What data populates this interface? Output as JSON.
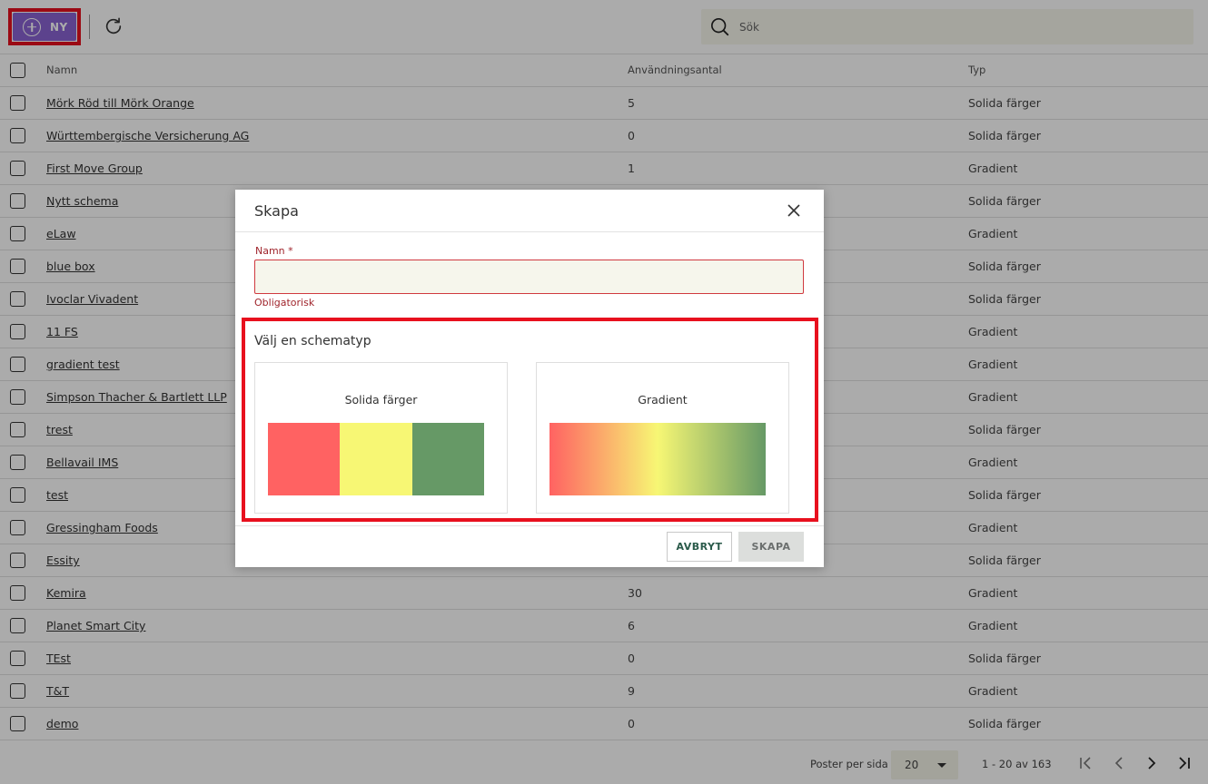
{
  "toolbar": {
    "new_label": "NY",
    "search_placeholder": "Sök"
  },
  "table": {
    "headers": {
      "name": "Namn",
      "count": "Användningsantal",
      "type": "Typ"
    },
    "rows": [
      {
        "name": "Mörk Röd till Mörk Orange",
        "count": "5",
        "type": "Solida färger"
      },
      {
        "name": "Württembergische Versicherung AG",
        "count": "0",
        "type": "Solida färger"
      },
      {
        "name": "First Move Group",
        "count": "1",
        "type": "Gradient"
      },
      {
        "name": "Nytt schema",
        "count": "",
        "type": "Solida färger"
      },
      {
        "name": "eLaw",
        "count": "",
        "type": "Gradient"
      },
      {
        "name": "blue box",
        "count": "",
        "type": "Solida färger"
      },
      {
        "name": "Ivoclar Vivadent",
        "count": "",
        "type": "Solida färger"
      },
      {
        "name": "11 FS",
        "count": "",
        "type": "Gradient"
      },
      {
        "name": "gradient test",
        "count": "",
        "type": "Gradient"
      },
      {
        "name": "Simpson Thacher & Bartlett LLP",
        "count": "",
        "type": "Gradient"
      },
      {
        "name": "trest",
        "count": "",
        "type": "Solida färger"
      },
      {
        "name": "Bellavail IMS",
        "count": "",
        "type": "Gradient"
      },
      {
        "name": "test",
        "count": "",
        "type": "Solida färger"
      },
      {
        "name": "Gressingham Foods",
        "count": "",
        "type": "Gradient"
      },
      {
        "name": "Essity",
        "count": "",
        "type": "Solida färger"
      },
      {
        "name": "Kemira",
        "count": "30",
        "type": "Gradient"
      },
      {
        "name": "Planet Smart City",
        "count": "6",
        "type": "Gradient"
      },
      {
        "name": "TEst",
        "count": "0",
        "type": "Solida färger"
      },
      {
        "name": "T&T",
        "count": "9",
        "type": "Gradient"
      },
      {
        "name": "demo",
        "count": "0",
        "type": "Solida färger"
      }
    ]
  },
  "pagination": {
    "per_page_label": "Poster per sida",
    "per_page_value": "20",
    "range": "1 - 20 av 163"
  },
  "modal": {
    "title": "Skapa",
    "name_label": "Namn *",
    "name_value": "",
    "name_error": "Obligatorisk",
    "schema_title": "Välj en schematyp",
    "option_solid": "Solida färger",
    "option_gradient": "Gradient",
    "cancel_label": "AVBRYT",
    "create_label": "SKAPA"
  },
  "colors": {
    "accent_purple": "#8a63d2",
    "highlight_red": "#e8101e",
    "swatch_red": "#ff6262",
    "swatch_yellow": "#f7f774",
    "swatch_green": "#669966"
  },
  "icons": {
    "new": "plus-circle-icon",
    "refresh": "refresh-icon",
    "search": "search-icon",
    "close": "close-icon",
    "dropdown": "caret-down-icon",
    "first": "first-page-icon",
    "prev": "chevron-left-icon",
    "next": "chevron-right-icon",
    "last": "last-page-icon"
  }
}
